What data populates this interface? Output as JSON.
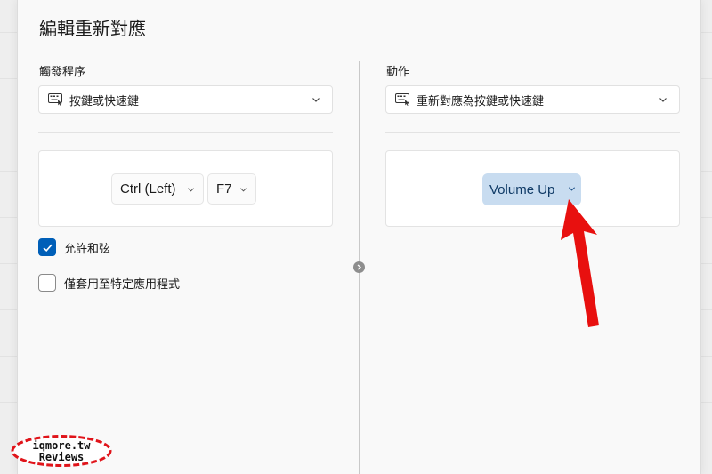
{
  "dialog": {
    "title": "編輯重新對應"
  },
  "trigger": {
    "label": "觸發程序",
    "dropdown_value": "按鍵或快速鍵",
    "keys": [
      "Ctrl (Left)",
      "F7"
    ],
    "allow_chords": {
      "label": "允許和弦",
      "checked": true
    },
    "apply_to_app": {
      "label": "僅套用至特定應用程式",
      "checked": false
    }
  },
  "action": {
    "label": "動作",
    "dropdown_value": "重新對應為按鍵或快速鍵",
    "target_key": "Volume Up"
  },
  "watermark": {
    "line1": "iqmore.tw",
    "line2": "Reviews"
  },
  "colors": {
    "accent": "#005fb8",
    "highlight_button": "#c8dcf0",
    "annotation_arrow": "#e8100f"
  }
}
